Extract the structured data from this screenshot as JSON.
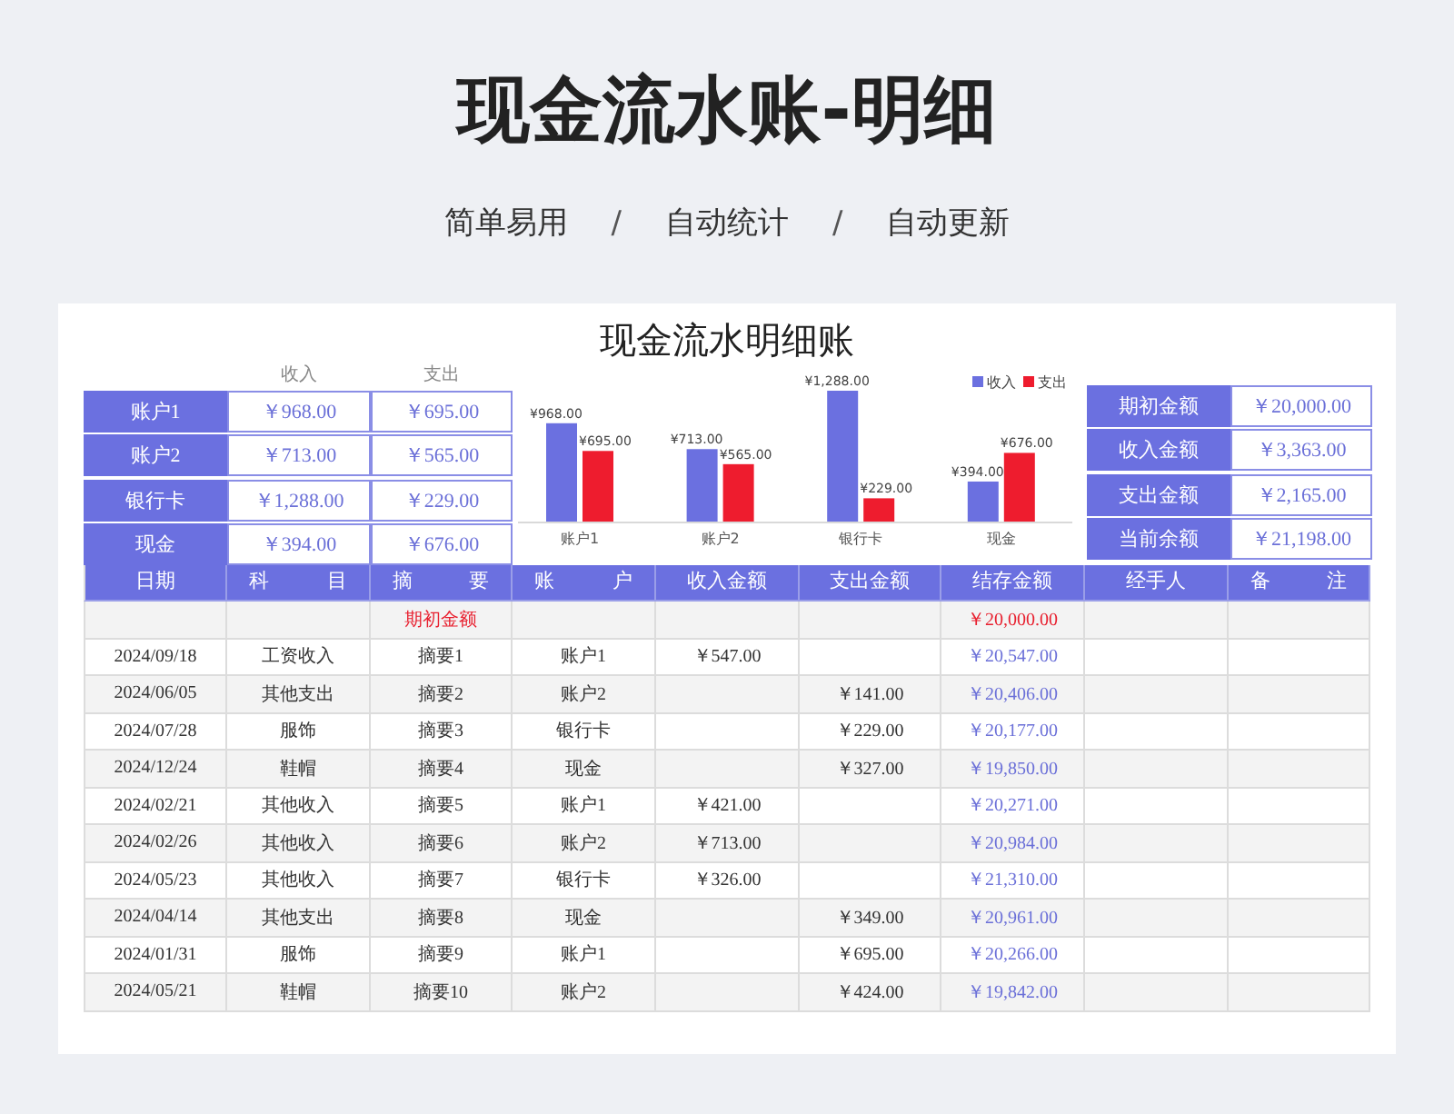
{
  "header": {
    "title": "现金流水账-明细",
    "subtitle": [
      {
        "kind": "text",
        "text": "简单易用"
      },
      {
        "kind": "sep",
        "text": "/"
      },
      {
        "kind": "text",
        "text": "自动统计"
      },
      {
        "kind": "sep",
        "text": "/"
      },
      {
        "kind": "text",
        "text": "自动更新"
      }
    ]
  },
  "sheet": {
    "title": "现金流水明细账",
    "account_summary": {
      "columns": [
        "收入",
        "支出"
      ],
      "rows": [
        {
          "account": "账户1",
          "income": "￥968.00",
          "expense": "￥695.00"
        },
        {
          "account": "账户2",
          "income": "￥713.00",
          "expense": "￥565.00"
        },
        {
          "account": "银行卡",
          "income": "￥1,288.00",
          "expense": "￥229.00"
        },
        {
          "account": "现金",
          "income": "￥394.00",
          "expense": "￥676.00"
        }
      ]
    },
    "chart_data": {
      "type": "bar",
      "categories": [
        "账户1",
        "账户2",
        "银行卡",
        "现金"
      ],
      "legend": "top-right",
      "data_labels": true,
      "series": [
        {
          "name": "收入",
          "color": "#6b70e0",
          "values": [
            968,
            713,
            1288,
            394
          ],
          "value_labels": [
            "¥968.00",
            "¥713.00",
            "¥1,288.00",
            "¥394.00"
          ]
        },
        {
          "name": "支出",
          "color": "#ee1c2e",
          "values": [
            695,
            565,
            229,
            676
          ],
          "value_labels": [
            "¥695.00",
            "¥565.00",
            "¥229.00",
            "¥676.00"
          ]
        }
      ]
    },
    "totals": [
      {
        "label": "期初金额",
        "value": "￥20,000.00"
      },
      {
        "label": "收入金额",
        "value": "￥3,363.00"
      },
      {
        "label": "支出金额",
        "value": "￥2,165.00"
      },
      {
        "label": "当前余额",
        "value": "￥21,198.00"
      }
    ],
    "ledger": {
      "columns": [
        "日期",
        "科 目",
        "摘 要",
        "账 户",
        "收入金额",
        "支出金额",
        "结存金额",
        "经手人",
        "备 注"
      ],
      "rows": [
        {
          "kind": "opening",
          "summary": "期初金额",
          "balance": "￥20,000.00"
        },
        {
          "kind": "entry",
          "date": "2024/09/18",
          "category": "工资收入",
          "summary": "摘要1",
          "account": "账户1",
          "income": "￥547.00",
          "balance": "￥20,547.00"
        },
        {
          "kind": "entry",
          "date": "2024/06/05",
          "category": "其他支出",
          "summary": "摘要2",
          "account": "账户2",
          "expense": "￥141.00",
          "balance": "￥20,406.00"
        },
        {
          "kind": "entry",
          "date": "2024/07/28",
          "category": "服饰",
          "summary": "摘要3",
          "account": "银行卡",
          "expense": "￥229.00",
          "balance": "￥20,177.00"
        },
        {
          "kind": "entry",
          "date": "2024/12/24",
          "category": "鞋帽",
          "summary": "摘要4",
          "account": "现金",
          "expense": "￥327.00",
          "balance": "￥19,850.00"
        },
        {
          "kind": "entry",
          "date": "2024/02/21",
          "category": "其他收入",
          "summary": "摘要5",
          "account": "账户1",
          "income": "￥421.00",
          "balance": "￥20,271.00"
        },
        {
          "kind": "entry",
          "date": "2024/02/26",
          "category": "其他收入",
          "summary": "摘要6",
          "account": "账户2",
          "income": "￥713.00",
          "balance": "￥20,984.00"
        },
        {
          "kind": "entry",
          "date": "2024/05/23",
          "category": "其他收入",
          "summary": "摘要7",
          "account": "银行卡",
          "income": "￥326.00",
          "balance": "￥21,310.00"
        },
        {
          "kind": "entry",
          "date": "2024/04/14",
          "category": "其他支出",
          "summary": "摘要8",
          "account": "现金",
          "expense": "￥349.00",
          "balance": "￥20,961.00"
        },
        {
          "kind": "entry",
          "date": "2024/01/31",
          "category": "服饰",
          "summary": "摘要9",
          "account": "账户1",
          "expense": "￥695.00",
          "balance": "￥20,266.00"
        },
        {
          "kind": "entry",
          "date": "2024/05/21",
          "category": "鞋帽",
          "summary": "摘要10",
          "account": "账户2",
          "expense": "￥424.00",
          "balance": "￥19,842.00"
        }
      ]
    }
  }
}
